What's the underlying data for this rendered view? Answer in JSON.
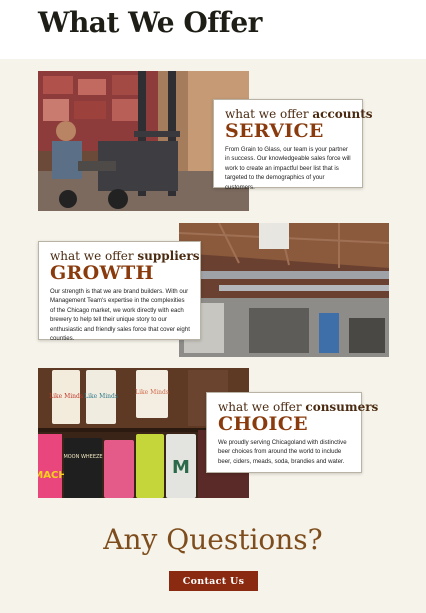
{
  "page": {
    "title": "What We Offer"
  },
  "sections": [
    {
      "id": "accounts",
      "prefix": "what we offer ",
      "audience": "accounts",
      "word": "SERVICE",
      "body": "From Grain to Glass, our team is your partner in success. Our knowledgeable sales force will work to create an impactful beer list that is targeted to the demographics of your customers.",
      "image_subject": "worker-on-forklift-photo"
    },
    {
      "id": "suppliers",
      "prefix": "what we offer ",
      "audience": "suppliers",
      "word": "GROWTH",
      "body": "Our strength is that we are brand builders. With our Management Team's expertise in the complexities of the Chicago market, we work directly with each brewery to help tell their unique story to our enthusiastic and friendly sales force that cover eight counties.",
      "image_subject": "warehouse-interior-photo"
    },
    {
      "id": "consumers",
      "prefix": "what we offer ",
      "audience": "consumers",
      "word": "CHOICE",
      "body": "We proudly serving Chicagoland with distinctive beer choices from around the world to include beer, ciders, meads, soda, brandies and water.",
      "image_subject": "beer-cans-shelf-photo"
    }
  ],
  "questions": {
    "heading": "Any Questions?",
    "cta_label": "Contact Us"
  },
  "can_labels": {
    "can1": "Like Minds",
    "can2": "Like Minds",
    "can3": "Like Minds",
    "can4": "MACH",
    "can5": "MOON WHEEZE",
    "can6": "M"
  },
  "colors": {
    "background": "#f6f3ea",
    "accent_brown": "#8a3b0d",
    "heading_dark": "#1e1e16",
    "cta_red": "#8a2a10",
    "questions_color": "#7e4d1d"
  }
}
